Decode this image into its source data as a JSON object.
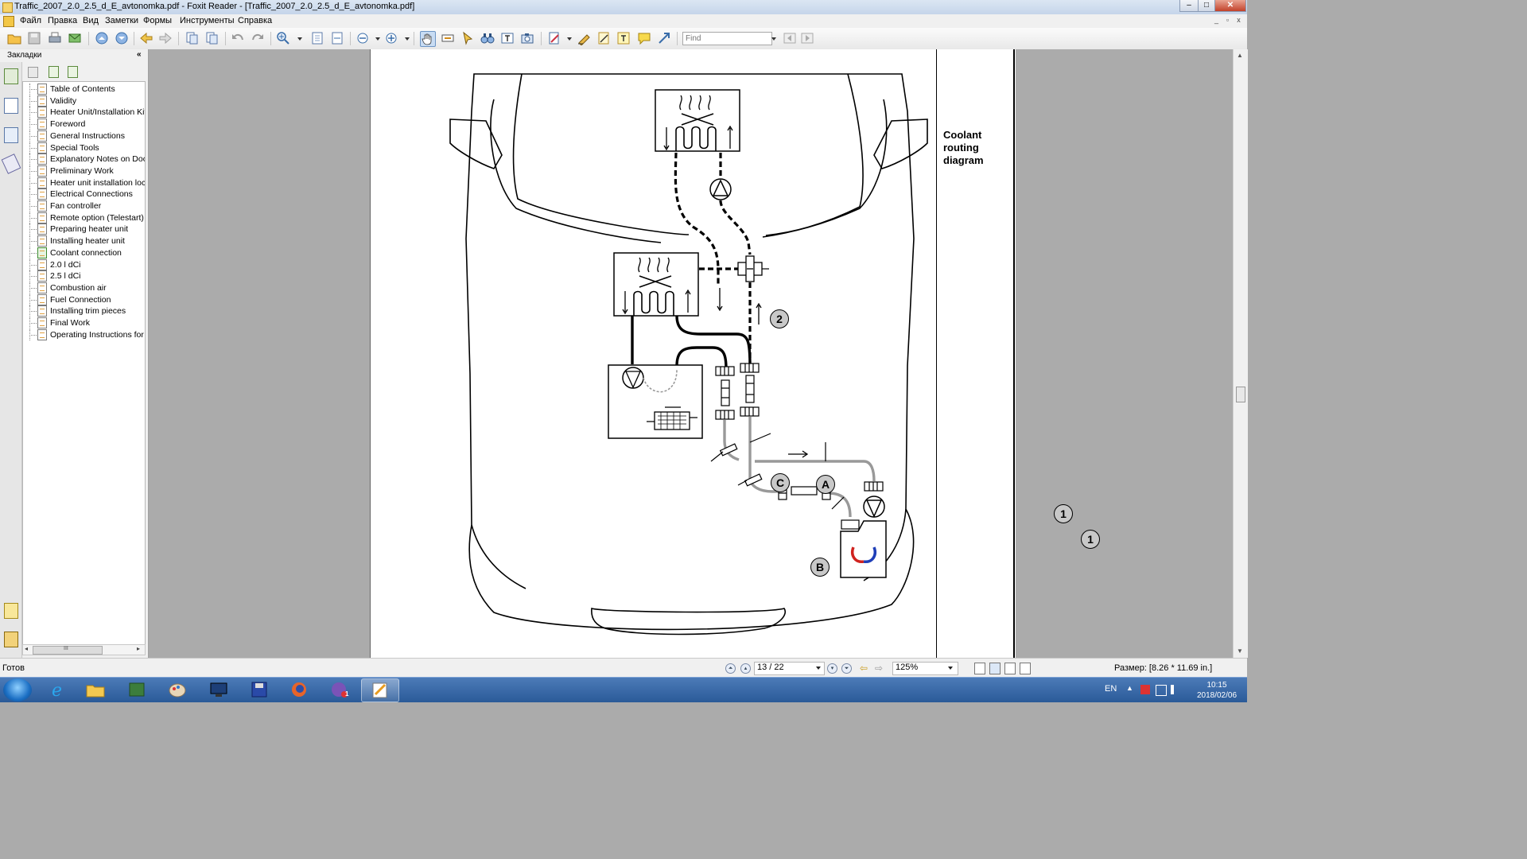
{
  "window": {
    "title": "Traffic_2007_2.0_2.5_d_E_avtonomka.pdf - Foxit Reader - [Traffic_2007_2.0_2.5_d_E_avtonomka.pdf]",
    "minimize": "–",
    "maximize": "□",
    "close": "✕"
  },
  "menu": {
    "items": [
      "Файл",
      "Правка",
      "Вид",
      "Заметки",
      "Формы",
      "Инструменты",
      "Справка"
    ]
  },
  "toolbar": {
    "find_placeholder": "Find"
  },
  "bookmarks": {
    "title": "Закладки",
    "collapse": "«",
    "items": [
      "Table of Contents",
      "Validity",
      "Heater Unit/Installation Kit",
      "Foreword",
      "General Instructions",
      "Special Tools",
      "Explanatory Notes on Docu",
      "Preliminary Work",
      "Heater unit installation loca",
      "Electrical Connections",
      "Fan controller",
      "Remote option (Telestart)",
      "Preparing heater unit",
      "Installing heater unit",
      "Coolant connection",
      "2.0 l dCi",
      "2.5 l dCi",
      "Combustion air",
      "Fuel Connection",
      "Installing trim pieces",
      "Final Work",
      "Operating Instructions for"
    ],
    "active_index": 14,
    "scroll_marker": "III"
  },
  "document": {
    "caption": "Coolant routing diagram",
    "labels": {
      "label_1a": "1",
      "label_1b": "1",
      "label_2": "2",
      "label_a": "A",
      "label_b": "B",
      "label_c": "C"
    }
  },
  "statusbar": {
    "ready": "Готов",
    "page": "13 / 22",
    "zoom": "125%",
    "size": "Размер: [8.26 * 11.69 in.]"
  },
  "taskbar": {
    "lang": "EN",
    "time": "10:15",
    "date": "2018/02/06",
    "notify_badge": "1"
  }
}
